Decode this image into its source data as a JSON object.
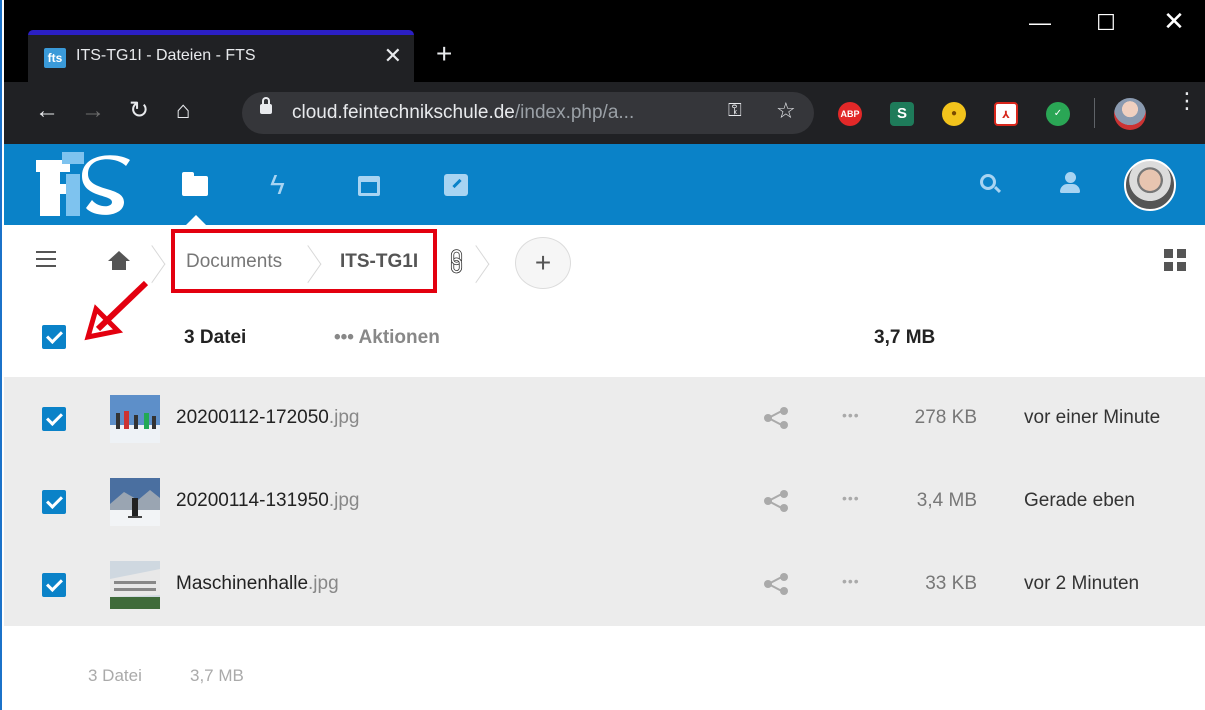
{
  "browser": {
    "tab_title": "ITS-TG1I - Dateien - FTS",
    "tab_favicon": "fts",
    "new_tab": "+",
    "url_host": "cloud.feintechnikschule.de",
    "url_path": "/index.php/a...",
    "extensions": [
      "ABP",
      "S",
      "",
      "",
      ""
    ]
  },
  "app": {
    "logo_text": "fts",
    "nav_icons": [
      "folder-icon",
      "bolt-icon",
      "calendar-icon",
      "notes-icon"
    ],
    "right_icons": [
      "search-icon",
      "contacts-icon",
      "avatar"
    ],
    "accent": "#0a82c8"
  },
  "breadcrumb": {
    "items": [
      {
        "label": "Documents"
      },
      {
        "label": "ITS-TG1I"
      }
    ],
    "add": "+"
  },
  "header": {
    "count": "3 Datei",
    "actions": "••• Aktionen",
    "size": "3,7 MB"
  },
  "files": [
    {
      "name": "20200112-172050",
      "ext": ".jpg",
      "size": "278 KB",
      "date": "vor einer Minute",
      "more": "•••"
    },
    {
      "name": "20200114-131950",
      "ext": ".jpg",
      "size": "3,4 MB",
      "date": "Gerade eben",
      "more": "•••"
    },
    {
      "name": "Maschinenhalle",
      "ext": ".jpg",
      "size": "33 KB",
      "date": "vor 2 Minuten",
      "more": "•••"
    }
  ],
  "footer": {
    "count": "3 Datei",
    "size": "3,7 MB"
  }
}
